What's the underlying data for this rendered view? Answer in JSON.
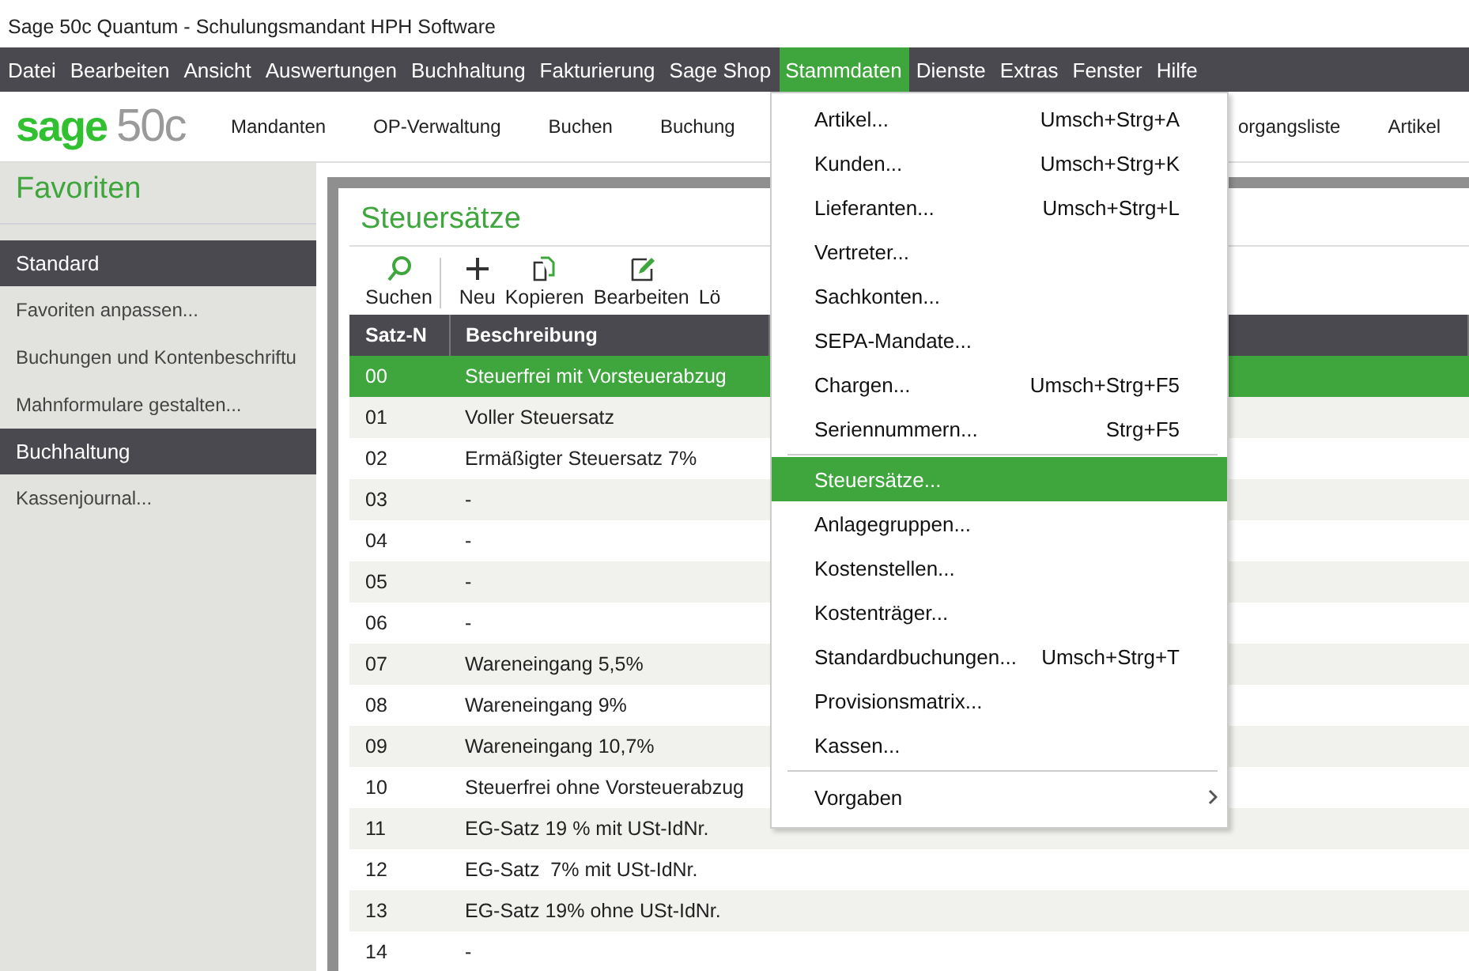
{
  "window": {
    "title": "Sage 50c Quantum - Schulungsmandant HPH Software"
  },
  "menubar": [
    {
      "label": "Datei",
      "selected": false
    },
    {
      "label": "Bearbeiten",
      "selected": false
    },
    {
      "label": "Ansicht",
      "selected": false
    },
    {
      "label": "Auswertungen",
      "selected": false
    },
    {
      "label": "Buchhaltung",
      "selected": false
    },
    {
      "label": "Fakturierung",
      "selected": false
    },
    {
      "label": "Sage Shop",
      "selected": false
    },
    {
      "label": "Stammdaten",
      "selected": true
    },
    {
      "label": "Dienste",
      "selected": false
    },
    {
      "label": "Extras",
      "selected": false
    },
    {
      "label": "Fenster",
      "selected": false
    },
    {
      "label": "Hilfe",
      "selected": false
    }
  ],
  "logo": {
    "brand": "sage",
    "product": "50c"
  },
  "ribbon": {
    "items": [
      "Mandanten",
      "OP-Verwaltung",
      "Buchen",
      "Buchung"
    ],
    "items_right": [
      "organgsliste",
      "Artikel"
    ]
  },
  "sidebar": {
    "title": "Favoriten",
    "groups": [
      {
        "header": "Standard",
        "items": [
          "Favoriten anpassen...",
          "Buchungen und Kontenbeschriftu",
          "Mahnformulare gestalten..."
        ]
      },
      {
        "header": "Buchhaltung",
        "items": [
          "Kassenjournal..."
        ]
      }
    ]
  },
  "panel": {
    "title": "Steuersätze",
    "toolbar": [
      {
        "kind": "search",
        "label": "Suchen"
      },
      {
        "kind": "new",
        "label": "Neu"
      },
      {
        "kind": "copy",
        "label": "Kopieren"
      },
      {
        "kind": "edit",
        "label": "Bearbeiten"
      },
      {
        "kind": "plain",
        "label": "Lö"
      }
    ],
    "table": {
      "columns": [
        "Satz-N",
        "Beschreibung"
      ],
      "rows": [
        {
          "cells": [
            "00",
            "Steuerfrei mit Vorsteuerabzug"
          ],
          "selected": true
        },
        {
          "cells": [
            "01",
            "Voller Steuersatz"
          ],
          "selected": false
        },
        {
          "cells": [
            "02",
            "Ermäßigter Steuersatz 7%"
          ],
          "selected": false
        },
        {
          "cells": [
            "03",
            "-"
          ],
          "selected": false
        },
        {
          "cells": [
            "04",
            "-"
          ],
          "selected": false
        },
        {
          "cells": [
            "05",
            "-"
          ],
          "selected": false
        },
        {
          "cells": [
            "06",
            "-"
          ],
          "selected": false
        },
        {
          "cells": [
            "07",
            "Wareneingang 5,5%"
          ],
          "selected": false
        },
        {
          "cells": [
            "08",
            "Wareneingang 9%"
          ],
          "selected": false
        },
        {
          "cells": [
            "09",
            "Wareneingang 10,7%"
          ],
          "selected": false
        },
        {
          "cells": [
            "10",
            "Steuerfrei ohne Vorsteuerabzug"
          ],
          "selected": false
        },
        {
          "cells": [
            "11",
            "EG-Satz 19 % mit USt-IdNr."
          ],
          "selected": false
        },
        {
          "cells": [
            "12",
            "EG-Satz  7% mit USt-IdNr."
          ],
          "selected": false
        },
        {
          "cells": [
            "13",
            "EG-Satz 19% ohne USt-IdNr."
          ],
          "selected": false
        },
        {
          "cells": [
            "14",
            "-"
          ],
          "selected": false
        }
      ]
    }
  },
  "dropdown": [
    {
      "kind": "item",
      "label": "Artikel...",
      "shortcut": "Umsch+Strg+A",
      "selected": false
    },
    {
      "kind": "item",
      "label": "Kunden...",
      "shortcut": "Umsch+Strg+K",
      "selected": false
    },
    {
      "kind": "item",
      "label": "Lieferanten...",
      "shortcut": "Umsch+Strg+L",
      "selected": false
    },
    {
      "kind": "item",
      "label": "Vertreter...",
      "selected": false
    },
    {
      "kind": "item",
      "label": "Sachkonten...",
      "selected": false
    },
    {
      "kind": "item",
      "label": "SEPA-Mandate...",
      "selected": false
    },
    {
      "kind": "item",
      "label": "Chargen...",
      "shortcut": "Umsch+Strg+F5",
      "selected": false
    },
    {
      "kind": "item",
      "label": "Seriennummern...",
      "shortcut": "Strg+F5",
      "selected": false
    },
    {
      "kind": "separator"
    },
    {
      "kind": "item",
      "label": "Steuersätze...",
      "selected": true
    },
    {
      "kind": "item",
      "label": "Anlagegruppen...",
      "selected": false
    },
    {
      "kind": "item",
      "label": "Kostenstellen...",
      "selected": false
    },
    {
      "kind": "item",
      "label": "Kostenträger...",
      "selected": false
    },
    {
      "kind": "item",
      "label": "Standardbuchungen...",
      "shortcut": "Umsch+Strg+T",
      "selected": false
    },
    {
      "kind": "item",
      "label": "Provisionsmatrix...",
      "selected": false
    },
    {
      "kind": "item",
      "label": "Kassen...",
      "selected": false
    },
    {
      "kind": "separator"
    },
    {
      "kind": "submenu",
      "label": "Vorgaben",
      "selected": false
    }
  ]
}
